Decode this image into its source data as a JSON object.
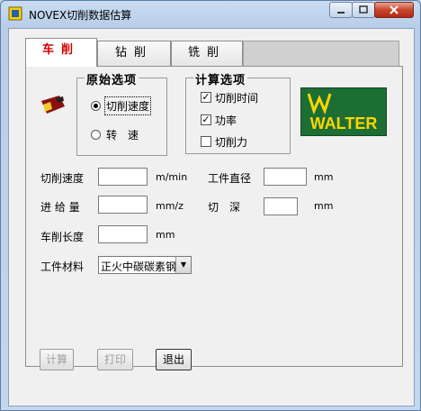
{
  "window": {
    "title": "NOVEX切削数据估算"
  },
  "tabs": [
    {
      "label": "车削",
      "active": true
    },
    {
      "label": "钻削",
      "active": false
    },
    {
      "label": "铣削",
      "active": false
    }
  ],
  "raw_options": {
    "title": "原始选项",
    "options": [
      {
        "label": "切削速度",
        "selected": true
      },
      {
        "label": "转　速",
        "selected": false
      }
    ]
  },
  "calc_options": {
    "title": "计算选项",
    "options": [
      {
        "label": "切削时间",
        "checked": true
      },
      {
        "label": "功率",
        "checked": true
      },
      {
        "label": "切削力",
        "checked": false
      }
    ]
  },
  "logo": {
    "text": "WALTER",
    "color": "#1c6e34",
    "text_color": "#ffd500"
  },
  "fields": {
    "cutting_speed": {
      "label": "切削速度",
      "value": "",
      "unit": "m/min"
    },
    "workpiece_diameter": {
      "label": "工件直径",
      "value": "",
      "unit": "mm"
    },
    "feed": {
      "label": "进 给 量",
      "value": "",
      "unit": "mm/z"
    },
    "depth": {
      "label": "切　深",
      "value": "",
      "unit": "mm"
    },
    "cut_length": {
      "label": "车削长度",
      "value": "",
      "unit": "mm"
    }
  },
  "material": {
    "label": "工件材料",
    "selected": "正火中碳碳素钢"
  },
  "buttons": {
    "calculate": "计算",
    "print": "打印",
    "exit": "退出"
  },
  "icons": {
    "app": "novex-app-icon",
    "tool": "turning-tool-icon",
    "minimize": "minimize-icon",
    "maximize": "maximize-icon",
    "close": "close-icon"
  },
  "colors": {
    "active_tab": "#d40000",
    "titlebar": "#b9d1ea"
  }
}
